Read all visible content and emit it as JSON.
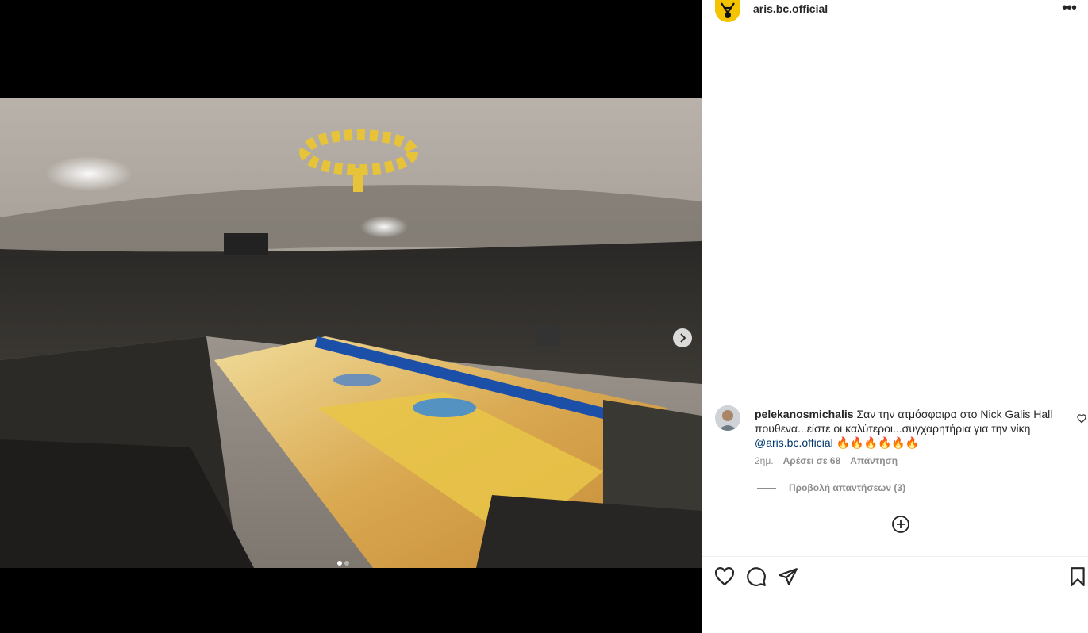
{
  "post": {
    "username": "aris.bc.official",
    "more_label": "•••",
    "carousel": {
      "current": 1,
      "total": 2
    }
  },
  "comment": {
    "username": "pelekanosmichalis",
    "text": "Σαν την ατμόσφαιρα στο Nick Galis Hall πουθενα...είστε οι καλύτεροι...συγχαρητήρια για την νίκη",
    "mention": "@aris.bc.official",
    "emojis": "🔥🔥🔥🔥🔥🔥",
    "time": "2ημ.",
    "likes": "Αρέσει σε 68",
    "reply": "Απάντηση",
    "view_replies": "Προβολή απαντήσεων (3)"
  },
  "colors": {
    "team_yellow": "#f5c400",
    "link_blue": "#00376b",
    "secondary_text": "#8e8e8e"
  },
  "icons": [
    "chevron-right-icon",
    "heart-icon",
    "comment-icon",
    "share-icon",
    "bookmark-icon",
    "plus-circle-icon",
    "more-icon"
  ]
}
